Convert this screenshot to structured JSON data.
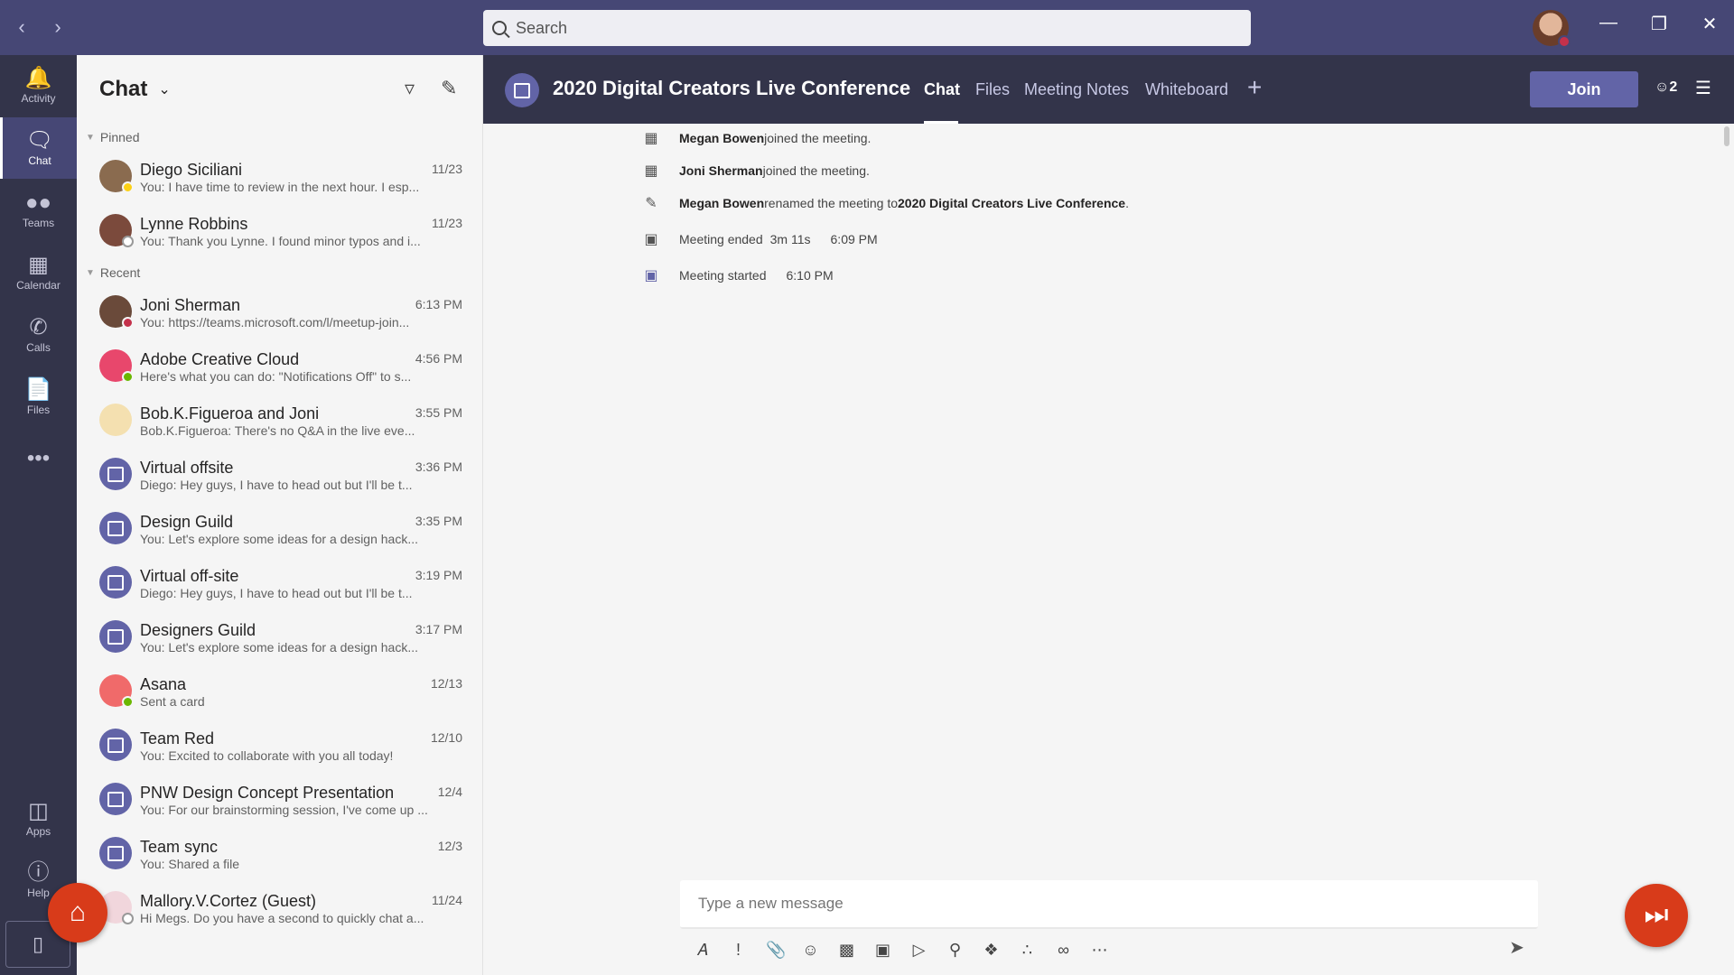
{
  "topbar": {
    "search_placeholder": "Search",
    "back_icon": "chevron-left-icon",
    "forward_icon": "chevron-right-icon",
    "minimize_icon": "minimize-icon",
    "restore_icon": "restore-icon",
    "close_icon": "close-icon"
  },
  "rail": {
    "items": [
      {
        "label": "Activity",
        "icon": "bell-icon"
      },
      {
        "label": "Chat",
        "icon": "chat-icon"
      },
      {
        "label": "Teams",
        "icon": "teams-icon"
      },
      {
        "label": "Calendar",
        "icon": "calendar-icon"
      },
      {
        "label": "Calls",
        "icon": "phone-icon"
      },
      {
        "label": "Files",
        "icon": "files-icon"
      }
    ],
    "more_glyph": "•••",
    "apps_label": "Apps",
    "help_label": "Help"
  },
  "chatlist": {
    "title": "Chat",
    "pinned_label": "Pinned",
    "recent_label": "Recent",
    "pinned": [
      {
        "name": "Diego Siciliani",
        "time": "11/23",
        "preview": "You: I have time to review in the next hour. I esp...",
        "avatar_color": "#8a6b4f",
        "presence_color": "#fcd116"
      },
      {
        "name": "Lynne Robbins",
        "time": "11/23",
        "preview": "You: Thank you Lynne. I found minor typos and i...",
        "avatar_color": "#7b4a3c",
        "presence_color": "#ffffff"
      }
    ],
    "recent": [
      {
        "name": "Joni Sherman",
        "time": "6:13 PM",
        "preview": "You: https://teams.microsoft.com/l/meetup-join...",
        "kind": "photo",
        "avatar_color": "#6a4a3a",
        "presence_color": "#c4314b"
      },
      {
        "name": "Adobe Creative Cloud",
        "time": "4:56 PM",
        "preview": "Here's what you can do: \"Notifications Off\" to s...",
        "kind": "app",
        "avatar_color": "#e8476c",
        "presence_color": "#6bb700"
      },
      {
        "name": "Bob.K.Figueroa and Joni",
        "time": "3:55 PM",
        "preview": "Bob.K.Figueroa: There's no Q&A in the live eve...",
        "kind": "group",
        "avatar_color": "#f4e0b0",
        "presence_color": ""
      },
      {
        "name": "Virtual offsite",
        "time": "3:36 PM",
        "preview": "Diego: Hey guys, I have to head out but I'll be t...",
        "kind": "meeting"
      },
      {
        "name": "Design Guild",
        "time": "3:35 PM",
        "preview": "You: Let's explore some ideas for a design hack...",
        "kind": "meeting"
      },
      {
        "name": "Virtual off-site",
        "time": "3:19 PM",
        "preview": "Diego: Hey guys, I have to head out but I'll be t...",
        "kind": "meeting"
      },
      {
        "name": "Designers Guild",
        "time": "3:17 PM",
        "preview": "You: Let's explore some ideas for a design hack...",
        "kind": "meeting"
      },
      {
        "name": "Asana",
        "time": "12/13",
        "preview": "Sent a card",
        "kind": "app",
        "avatar_color": "#f06a6a",
        "presence_color": "#6bb700"
      },
      {
        "name": "Team Red",
        "time": "12/10",
        "preview": "You: Excited to collaborate with you all today!",
        "kind": "meeting"
      },
      {
        "name": "PNW Design Concept Presentation",
        "time": "12/4",
        "preview": "You: For our brainstorming session, I've come up ...",
        "kind": "meeting"
      },
      {
        "name": "Team sync",
        "time": "12/3",
        "preview": "You: Shared a file",
        "kind": "meeting"
      },
      {
        "name": "Mallory.V.Cortez (Guest)",
        "time": "11/24",
        "preview": "Hi Megs. Do you have a second to quickly chat a...",
        "kind": "guest",
        "avatar_color": "#f1d6dc",
        "presence_color": "#ffffff"
      }
    ]
  },
  "header": {
    "title": "2020 Digital Creators Live Conference",
    "tabs": [
      "Chat",
      "Files",
      "Meeting Notes",
      "Whiteboard"
    ],
    "join_label": "Join",
    "participants_count": "2"
  },
  "messages": [
    {
      "icon": "calendar-add-icon",
      "actor": "Megan Bowen",
      "text": " joined the meeting."
    },
    {
      "icon": "calendar-add-icon",
      "actor": "Joni Sherman",
      "text": " joined the meeting."
    },
    {
      "icon": "pencil-icon",
      "actor": "Megan Bowen",
      "text": " renamed the meeting to ",
      "target": "2020 Digital Creators Live Conference",
      "tail": "."
    },
    {
      "icon": "video-ended-icon",
      "text": "Meeting ended",
      "duration": "3m 11s",
      "time": "6:09 PM"
    },
    {
      "icon": "video-icon",
      "text": "Meeting started",
      "time": "6:10 PM"
    }
  ],
  "composer": {
    "placeholder": "Type a new message"
  },
  "colors": {
    "brand": "#464775",
    "accent": "#6264a7",
    "fab": "#d83b1a"
  }
}
